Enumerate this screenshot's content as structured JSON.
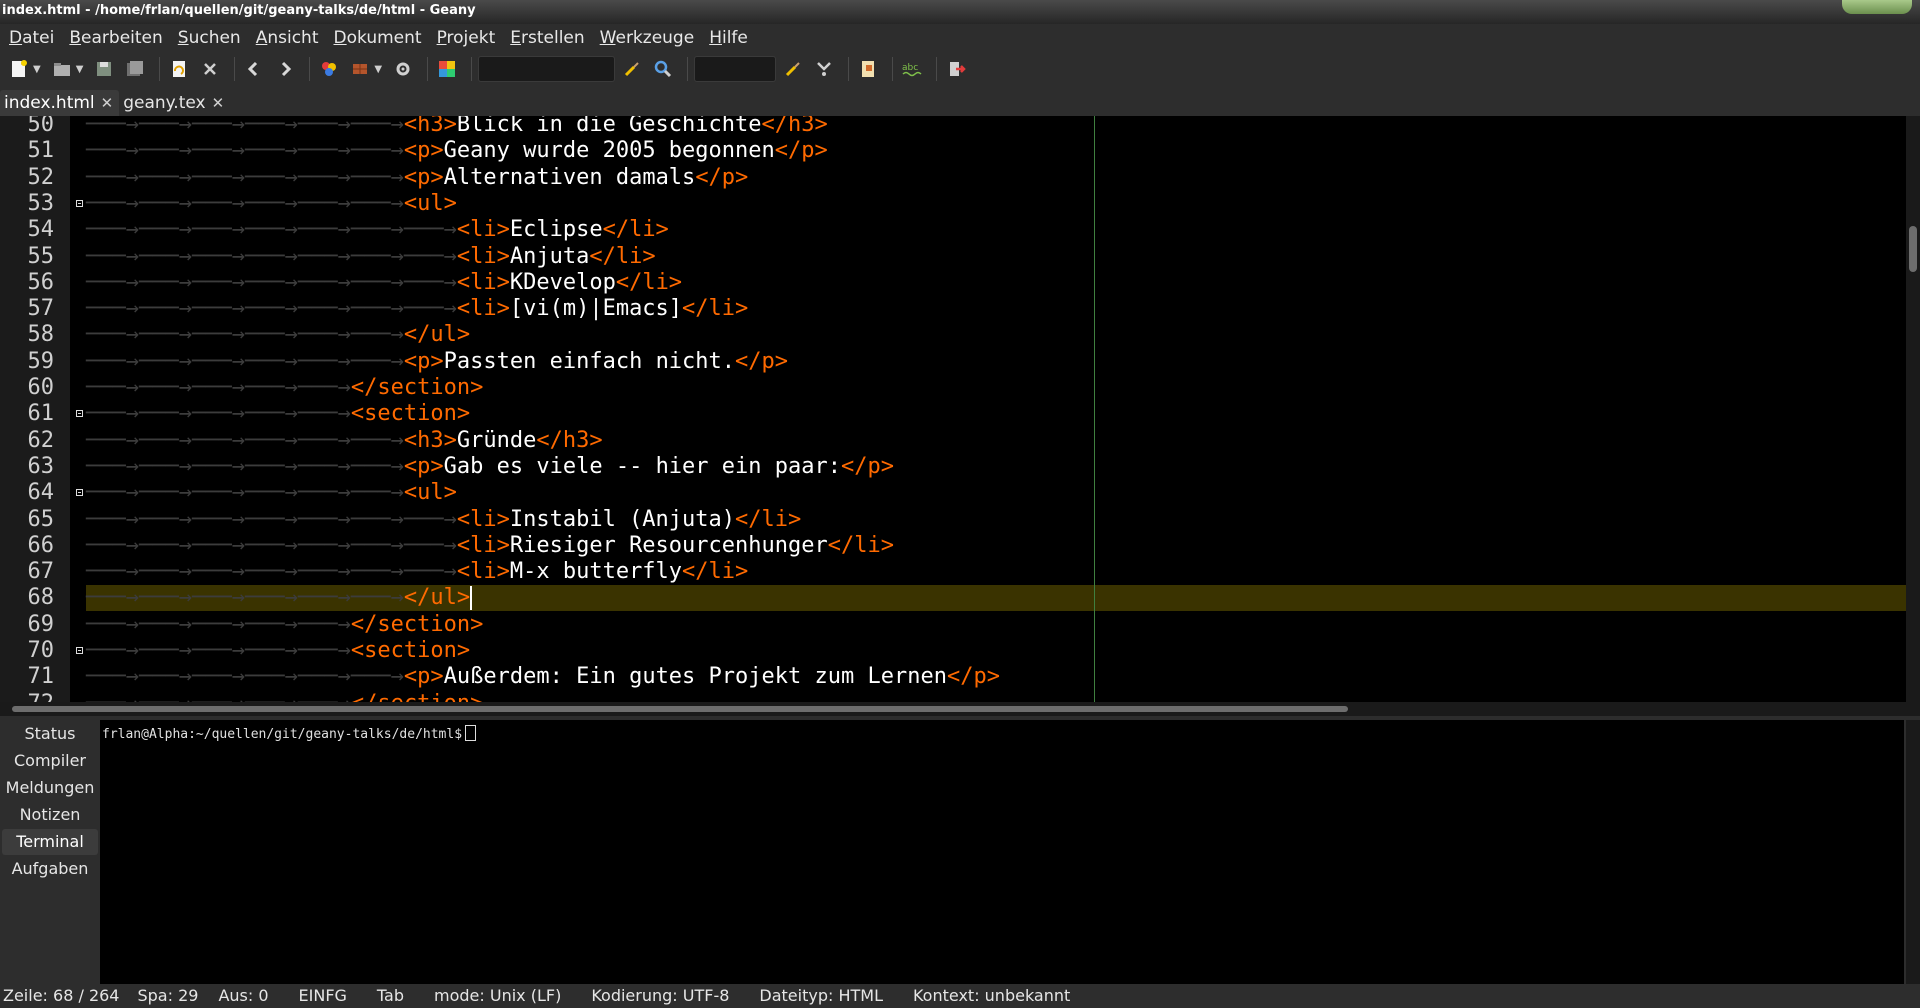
{
  "window": {
    "title": "index.html - /home/frlan/quellen/git/geany-talks/de/html - Geany"
  },
  "menubar": {
    "items": [
      {
        "accel": "D",
        "rest": "atei"
      },
      {
        "accel": "B",
        "rest": "earbeiten"
      },
      {
        "accel": "S",
        "rest": "uchen"
      },
      {
        "accel": "A",
        "rest": "nsicht"
      },
      {
        "accel": "D",
        "rest": "okument"
      },
      {
        "accel": "P",
        "rest": "rojekt"
      },
      {
        "accel": "E",
        "rest": "rstellen"
      },
      {
        "accel": "W",
        "rest": "erkzeuge"
      },
      {
        "accel": "H",
        "rest": "ilfe"
      }
    ]
  },
  "toolbar": {
    "icons": [
      "new-file-icon",
      "open-file-icon",
      "save-icon",
      "save-all-icon",
      "revert-icon",
      "close-file-icon",
      "back-icon",
      "forward-icon",
      "compile-icon",
      "build-icon",
      "run-icon",
      "color-chooser-icon",
      "clear-search-icon",
      "find-icon",
      "clear-goto-icon",
      "goto-line-icon",
      "preferences-icon",
      "spellcheck-icon",
      "quit-icon"
    ]
  },
  "tabs": [
    {
      "label": "index.html",
      "active": true
    },
    {
      "label": "geany.tex",
      "active": false
    }
  ],
  "editor": {
    "colors": {
      "tag": "#ff6a00",
      "text": "#ffffff",
      "current_line": "#3a3300",
      "edge": "#3f7f3f"
    },
    "lines": [
      {
        "num": "50",
        "indent": 6,
        "fold": false,
        "tokens": [
          [
            "tag",
            "<h3>"
          ],
          [
            "txt",
            "Blick in die Geschichte"
          ],
          [
            "tag",
            "</h3>"
          ]
        ]
      },
      {
        "num": "51",
        "indent": 6,
        "fold": false,
        "tokens": [
          [
            "tag",
            "<p>"
          ],
          [
            "txt",
            "Geany wurde 2005 begonnen"
          ],
          [
            "tag",
            "</p>"
          ]
        ]
      },
      {
        "num": "52",
        "indent": 6,
        "fold": false,
        "tokens": [
          [
            "tag",
            "<p>"
          ],
          [
            "txt",
            "Alternativen damals"
          ],
          [
            "tag",
            "</p>"
          ]
        ]
      },
      {
        "num": "53",
        "indent": 6,
        "fold": true,
        "tokens": [
          [
            "tag",
            "<ul>"
          ]
        ]
      },
      {
        "num": "54",
        "indent": 7,
        "fold": false,
        "tokens": [
          [
            "tag",
            "<li>"
          ],
          [
            "txt",
            "Eclipse"
          ],
          [
            "tag",
            "</li>"
          ]
        ]
      },
      {
        "num": "55",
        "indent": 7,
        "fold": false,
        "tokens": [
          [
            "tag",
            "<li>"
          ],
          [
            "txt",
            "Anjuta"
          ],
          [
            "tag",
            "</li>"
          ]
        ]
      },
      {
        "num": "56",
        "indent": 7,
        "fold": false,
        "tokens": [
          [
            "tag",
            "<li>"
          ],
          [
            "txt",
            "KDevelop"
          ],
          [
            "tag",
            "</li>"
          ]
        ]
      },
      {
        "num": "57",
        "indent": 7,
        "fold": false,
        "tokens": [
          [
            "tag",
            "<li>"
          ],
          [
            "txt",
            "[vi(m)|Emacs]"
          ],
          [
            "tag",
            "</li>"
          ]
        ]
      },
      {
        "num": "58",
        "indent": 6,
        "fold": false,
        "tokens": [
          [
            "tag",
            "</ul>"
          ]
        ]
      },
      {
        "num": "59",
        "indent": 6,
        "fold": false,
        "tokens": [
          [
            "tag",
            "<p>"
          ],
          [
            "txt",
            "Passten einfach nicht."
          ],
          [
            "tag",
            "</p>"
          ]
        ]
      },
      {
        "num": "60",
        "indent": 5,
        "fold": false,
        "tokens": [
          [
            "tag",
            "</section>"
          ]
        ]
      },
      {
        "num": "61",
        "indent": 5,
        "fold": true,
        "tokens": [
          [
            "tag",
            "<section>"
          ]
        ]
      },
      {
        "num": "62",
        "indent": 6,
        "fold": false,
        "tokens": [
          [
            "tag",
            "<h3>"
          ],
          [
            "txt",
            "Gründe"
          ],
          [
            "tag",
            "</h3>"
          ]
        ]
      },
      {
        "num": "63",
        "indent": 6,
        "fold": false,
        "tokens": [
          [
            "tag",
            "<p>"
          ],
          [
            "txt",
            "Gab es viele -- hier ein paar:"
          ],
          [
            "tag",
            "</p>"
          ]
        ]
      },
      {
        "num": "64",
        "indent": 6,
        "fold": true,
        "tokens": [
          [
            "tag",
            "<ul>"
          ]
        ]
      },
      {
        "num": "65",
        "indent": 7,
        "fold": false,
        "tokens": [
          [
            "tag",
            "<li>"
          ],
          [
            "txt",
            "Instabil (Anjuta)"
          ],
          [
            "tag",
            "</li>"
          ]
        ]
      },
      {
        "num": "66",
        "indent": 7,
        "fold": false,
        "tokens": [
          [
            "tag",
            "<li>"
          ],
          [
            "txt",
            "Riesiger Resourcenhunger"
          ],
          [
            "tag",
            "</li>"
          ]
        ]
      },
      {
        "num": "67",
        "indent": 7,
        "fold": false,
        "tokens": [
          [
            "tag",
            "<li>"
          ],
          [
            "txt",
            "M-x butterfly"
          ],
          [
            "tag",
            "</li>"
          ]
        ]
      },
      {
        "num": "68",
        "indent": 6,
        "fold": false,
        "current": true,
        "tokens": [
          [
            "tag",
            "</ul>"
          ]
        ]
      },
      {
        "num": "69",
        "indent": 5,
        "fold": false,
        "tokens": [
          [
            "tag",
            "</section>"
          ]
        ]
      },
      {
        "num": "70",
        "indent": 5,
        "fold": true,
        "tokens": [
          [
            "tag",
            "<section>"
          ]
        ]
      },
      {
        "num": "71",
        "indent": 6,
        "fold": false,
        "tokens": [
          [
            "tag",
            "<p>"
          ],
          [
            "txt",
            "Außerdem: Ein gutes Projekt zum Lernen"
          ],
          [
            "tag",
            "</p>"
          ]
        ]
      },
      {
        "num": "72",
        "indent": 5,
        "fold": false,
        "tokens": [
          [
            "tag",
            "</section>"
          ]
        ]
      }
    ]
  },
  "bottom_panel": {
    "tabs": [
      {
        "label": "Status",
        "active": false
      },
      {
        "label": "Compiler",
        "active": false
      },
      {
        "label": "Meldungen",
        "active": false
      },
      {
        "label": "Notizen",
        "active": false
      },
      {
        "label": "Terminal",
        "active": true
      },
      {
        "label": "Aufgaben",
        "active": false
      }
    ],
    "terminal_prompt": "frlan@Alpha:~/quellen/git/geany-talks/de/html$"
  },
  "statusbar": {
    "items": [
      "Zeile: 68 / 264",
      "Spa: 29",
      "Aus: 0",
      "EINFG",
      "Tab",
      "mode: Unix (LF)",
      "Kodierung: UTF-8",
      "Dateityp: HTML",
      "Kontext: unbekannt"
    ]
  }
}
